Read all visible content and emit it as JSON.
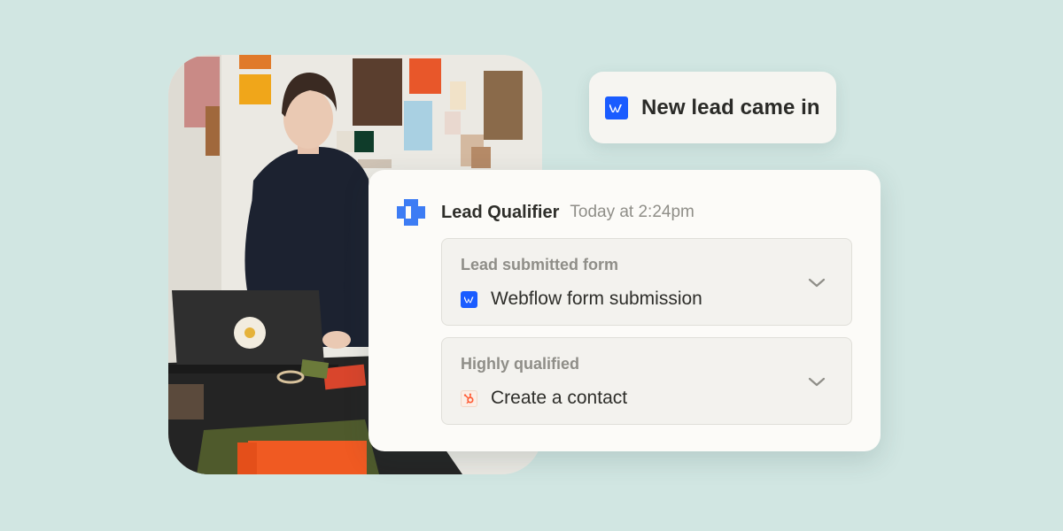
{
  "trigger": {
    "icon": "webflow-icon",
    "text": "New lead came in"
  },
  "card": {
    "agent_icon": "agent-puzzle-icon",
    "agent_name": "Lead Qualifier",
    "timestamp": "Today at 2:24pm",
    "steps": [
      {
        "label": "Lead submitted form",
        "icon": "webflow-icon",
        "title": "Webflow form submission"
      },
      {
        "label": "Highly qualified",
        "icon": "hubspot-icon",
        "title": "Create a contact"
      }
    ]
  },
  "colors": {
    "background": "#d1e6e2",
    "webflow_blue": "#1a5cff",
    "agent_blue": "#3d7cf4",
    "hubspot_orange": "#ff5c35"
  }
}
